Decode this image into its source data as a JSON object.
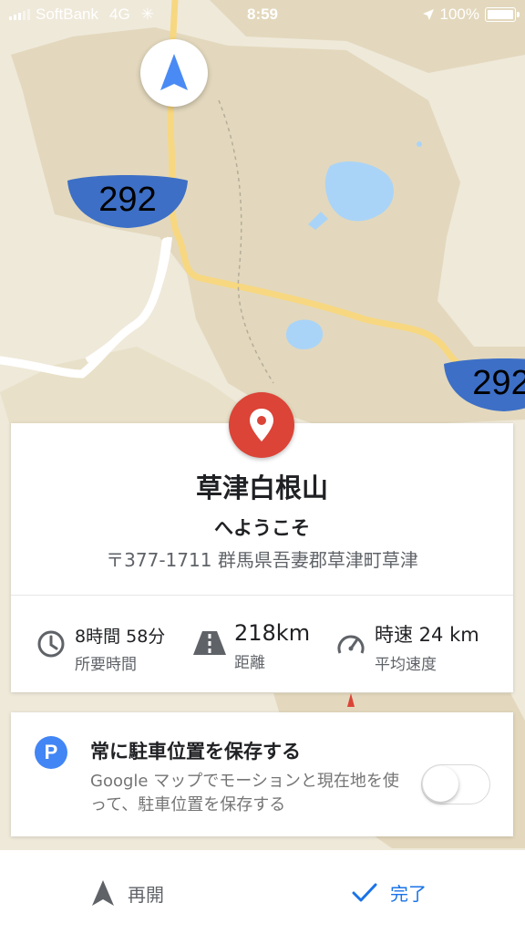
{
  "status_bar": {
    "carrier": "SoftBank",
    "network": "4G",
    "time": "8:59",
    "battery": "100%"
  },
  "map": {
    "route_shield_1": "292",
    "route_shield_2": "292",
    "compass_icon": "navigation-arrow-icon"
  },
  "destination": {
    "name": "草津白根山",
    "welcome": "へようこそ",
    "address": "〒377-1711 群馬県吾妻郡草津町草津",
    "pin_color": "#db4437"
  },
  "stats": [
    {
      "value": "8時間 58分",
      "label": "所要時間",
      "icon": "clock-icon"
    },
    {
      "value": "218km",
      "label": "距離",
      "icon": "road-icon"
    },
    {
      "value": "時速 24 km",
      "label": "平均速度",
      "icon": "speedometer-icon"
    }
  ],
  "parking": {
    "title": "常に駐車位置を保存する",
    "description": "Google マップでモーションと現在地を使って、駐車位置を保存する",
    "badge": "P",
    "toggle_on": false
  },
  "actions": {
    "resume_label": "再開",
    "done_label": "完了",
    "accent": "#1a73e8"
  }
}
